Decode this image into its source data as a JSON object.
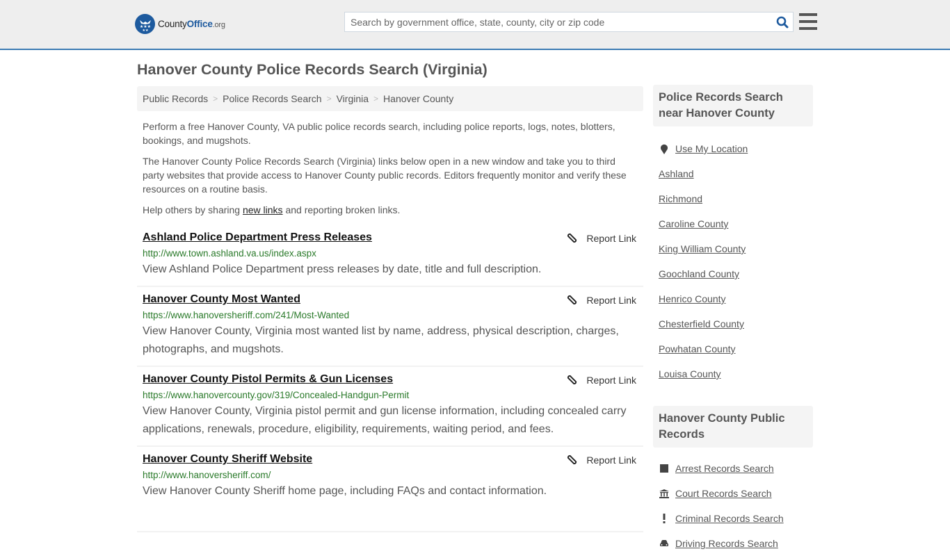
{
  "header": {
    "logo": {
      "brand_prefix": "County",
      "brand_main": "Office",
      "brand_suffix": ".org",
      "icon": "eagle-stars-badge-icon"
    },
    "search": {
      "placeholder": "Search by government office, state, county, city or zip code",
      "value": "",
      "icon": "search-icon"
    },
    "menu_icon": "hamburger-menu-icon"
  },
  "page": {
    "title": "Hanover County Police Records Search (Virginia)"
  },
  "breadcrumb": [
    {
      "label": "Public Records"
    },
    {
      "label": "Police Records Search"
    },
    {
      "label": "Virginia"
    },
    {
      "label": "Hanover County"
    }
  ],
  "breadcrumb_separator": ">",
  "intro": {
    "p1": "Perform a free Hanover County, VA public police records search, including police reports, logs, notes, blotters, bookings, and mugshots.",
    "p2": "The Hanover County Police Records Search (Virginia) links below open in a new window and take you to third party websites that provide access to Hanover County public records. Editors frequently monitor and verify these resources on a routine basis.",
    "p3_before": "Help others by sharing ",
    "p3_link": "new links",
    "p3_after": " and reporting broken links."
  },
  "results": [
    {
      "title": "Ashland Police Department Press Releases",
      "url": "http://www.town.ashland.va.us/index.aspx",
      "description": "View Ashland Police Department press releases by date, title and full description.",
      "report_label": "Report Link"
    },
    {
      "title": "Hanover County Most Wanted",
      "url": "https://www.hanoversheriff.com/241/Most-Wanted",
      "description": "View Hanover County, Virginia most wanted list by name, address, physical description, charges, photographs, and mugshots.",
      "report_label": "Report Link"
    },
    {
      "title": "Hanover County Pistol Permits & Gun Licenses",
      "url": "https://www.hanovercounty.gov/319/Concealed-Handgun-Permit",
      "description": "View Hanover County, Virginia pistol permit and gun license information, including concealed carry applications, renewals, procedure, eligibility, requirements, waiting period, and fees.",
      "report_label": "Report Link"
    },
    {
      "title": "Hanover County Sheriff Website",
      "url": "http://www.hanoversheriff.com/",
      "description": "View Hanover County Sheriff home page, including FAQs and contact information.",
      "report_label": "Report Link"
    }
  ],
  "sidebar": {
    "nearby": {
      "heading": "Police Records Search near Hanover County",
      "use_location": "Use My Location",
      "items": [
        "Ashland",
        "Richmond",
        "Caroline County",
        "King William County",
        "Goochland County",
        "Henrico County",
        "Chesterfield County",
        "Powhatan County",
        "Louisa County"
      ]
    },
    "public_records": {
      "heading": "Hanover County Public Records",
      "items": [
        {
          "label": "Arrest Records Search",
          "icon": "square-icon"
        },
        {
          "label": "Court Records Search",
          "icon": "courthouse-icon"
        },
        {
          "label": "Criminal Records Search",
          "icon": "exclamation-icon"
        },
        {
          "label": "Driving Records Search",
          "icon": "car-icon"
        }
      ]
    }
  },
  "colors": {
    "brand_blue": "#1d5a9e",
    "header_border": "#3a7ab3",
    "url_green": "#2a7a2a",
    "text_gray": "#555555"
  }
}
